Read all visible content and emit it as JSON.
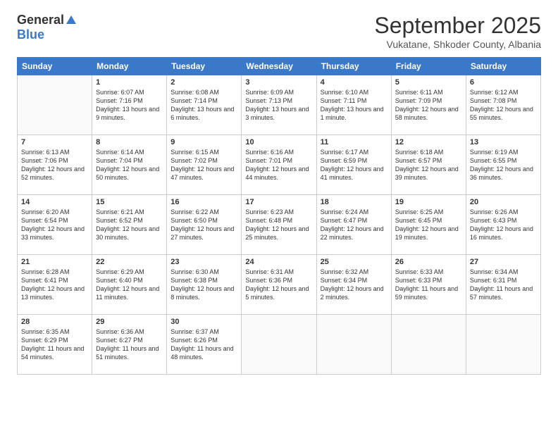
{
  "header": {
    "logo": {
      "general": "General",
      "blue": "Blue",
      "tagline": ""
    },
    "title": "September 2025",
    "location": "Vukatane, Shkoder County, Albania"
  },
  "weekdays": [
    "Sunday",
    "Monday",
    "Tuesday",
    "Wednesday",
    "Thursday",
    "Friday",
    "Saturday"
  ],
  "weeks": [
    [
      {
        "day": null
      },
      {
        "day": 1,
        "sunrise": "6:07 AM",
        "sunset": "7:16 PM",
        "daylight": "13 hours and 9 minutes."
      },
      {
        "day": 2,
        "sunrise": "6:08 AM",
        "sunset": "7:14 PM",
        "daylight": "13 hours and 6 minutes."
      },
      {
        "day": 3,
        "sunrise": "6:09 AM",
        "sunset": "7:13 PM",
        "daylight": "13 hours and 3 minutes."
      },
      {
        "day": 4,
        "sunrise": "6:10 AM",
        "sunset": "7:11 PM",
        "daylight": "13 hours and 1 minute."
      },
      {
        "day": 5,
        "sunrise": "6:11 AM",
        "sunset": "7:09 PM",
        "daylight": "12 hours and 58 minutes."
      },
      {
        "day": 6,
        "sunrise": "6:12 AM",
        "sunset": "7:08 PM",
        "daylight": "12 hours and 55 minutes."
      }
    ],
    [
      {
        "day": 7,
        "sunrise": "6:13 AM",
        "sunset": "7:06 PM",
        "daylight": "12 hours and 52 minutes."
      },
      {
        "day": 8,
        "sunrise": "6:14 AM",
        "sunset": "7:04 PM",
        "daylight": "12 hours and 50 minutes."
      },
      {
        "day": 9,
        "sunrise": "6:15 AM",
        "sunset": "7:02 PM",
        "daylight": "12 hours and 47 minutes."
      },
      {
        "day": 10,
        "sunrise": "6:16 AM",
        "sunset": "7:01 PM",
        "daylight": "12 hours and 44 minutes."
      },
      {
        "day": 11,
        "sunrise": "6:17 AM",
        "sunset": "6:59 PM",
        "daylight": "12 hours and 41 minutes."
      },
      {
        "day": 12,
        "sunrise": "6:18 AM",
        "sunset": "6:57 PM",
        "daylight": "12 hours and 39 minutes."
      },
      {
        "day": 13,
        "sunrise": "6:19 AM",
        "sunset": "6:55 PM",
        "daylight": "12 hours and 36 minutes."
      }
    ],
    [
      {
        "day": 14,
        "sunrise": "6:20 AM",
        "sunset": "6:54 PM",
        "daylight": "12 hours and 33 minutes."
      },
      {
        "day": 15,
        "sunrise": "6:21 AM",
        "sunset": "6:52 PM",
        "daylight": "12 hours and 30 minutes."
      },
      {
        "day": 16,
        "sunrise": "6:22 AM",
        "sunset": "6:50 PM",
        "daylight": "12 hours and 27 minutes."
      },
      {
        "day": 17,
        "sunrise": "6:23 AM",
        "sunset": "6:48 PM",
        "daylight": "12 hours and 25 minutes."
      },
      {
        "day": 18,
        "sunrise": "6:24 AM",
        "sunset": "6:47 PM",
        "daylight": "12 hours and 22 minutes."
      },
      {
        "day": 19,
        "sunrise": "6:25 AM",
        "sunset": "6:45 PM",
        "daylight": "12 hours and 19 minutes."
      },
      {
        "day": 20,
        "sunrise": "6:26 AM",
        "sunset": "6:43 PM",
        "daylight": "12 hours and 16 minutes."
      }
    ],
    [
      {
        "day": 21,
        "sunrise": "6:28 AM",
        "sunset": "6:41 PM",
        "daylight": "12 hours and 13 minutes."
      },
      {
        "day": 22,
        "sunrise": "6:29 AM",
        "sunset": "6:40 PM",
        "daylight": "12 hours and 11 minutes."
      },
      {
        "day": 23,
        "sunrise": "6:30 AM",
        "sunset": "6:38 PM",
        "daylight": "12 hours and 8 minutes."
      },
      {
        "day": 24,
        "sunrise": "6:31 AM",
        "sunset": "6:36 PM",
        "daylight": "12 hours and 5 minutes."
      },
      {
        "day": 25,
        "sunrise": "6:32 AM",
        "sunset": "6:34 PM",
        "daylight": "12 hours and 2 minutes."
      },
      {
        "day": 26,
        "sunrise": "6:33 AM",
        "sunset": "6:33 PM",
        "daylight": "11 hours and 59 minutes."
      },
      {
        "day": 27,
        "sunrise": "6:34 AM",
        "sunset": "6:31 PM",
        "daylight": "11 hours and 57 minutes."
      }
    ],
    [
      {
        "day": 28,
        "sunrise": "6:35 AM",
        "sunset": "6:29 PM",
        "daylight": "11 hours and 54 minutes."
      },
      {
        "day": 29,
        "sunrise": "6:36 AM",
        "sunset": "6:27 PM",
        "daylight": "11 hours and 51 minutes."
      },
      {
        "day": 30,
        "sunrise": "6:37 AM",
        "sunset": "6:26 PM",
        "daylight": "11 hours and 48 minutes."
      },
      {
        "day": null
      },
      {
        "day": null
      },
      {
        "day": null
      },
      {
        "day": null
      }
    ]
  ],
  "labels": {
    "sunrise": "Sunrise:",
    "sunset": "Sunset:",
    "daylight": "Daylight:"
  }
}
